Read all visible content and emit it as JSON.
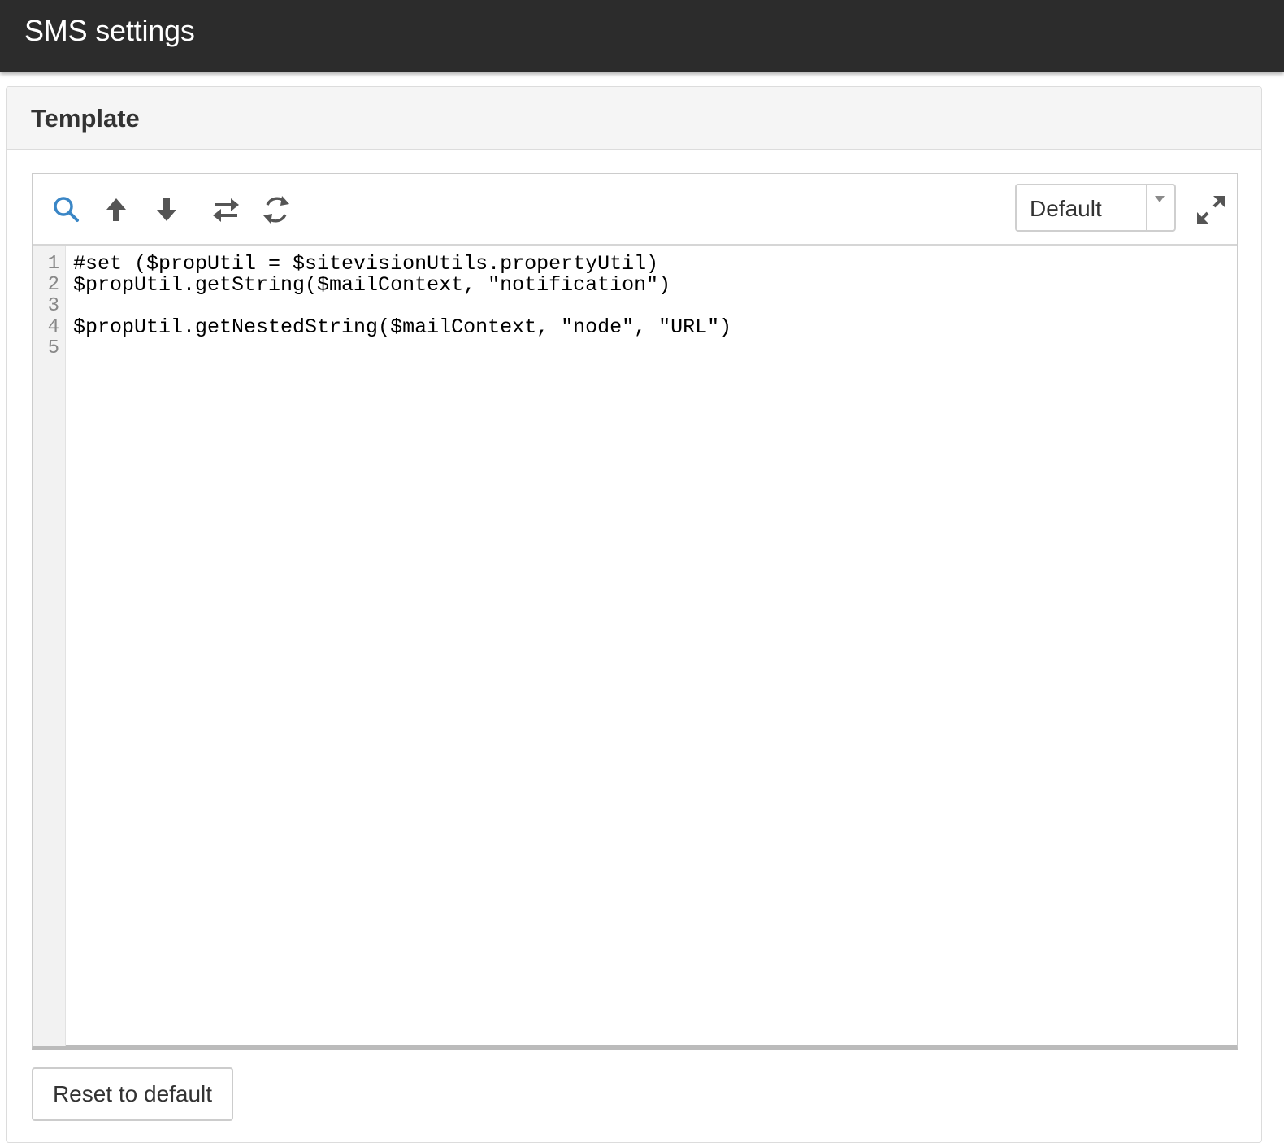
{
  "app": {
    "title": "SMS settings"
  },
  "panel": {
    "heading": "Template"
  },
  "toolbar": {
    "icons": [
      "search-icon",
      "arrow-up-icon",
      "arrow-down-icon",
      "replace-icon",
      "refresh-icon"
    ],
    "theme_select": {
      "selected": "Default"
    },
    "expand_icon": "expand-icon"
  },
  "editor": {
    "lines": [
      {
        "num": "1",
        "text": "#set ($propUtil = $sitevisionUtils.propertyUtil)"
      },
      {
        "num": "2",
        "text": "$propUtil.getString($mailContext, \"notification\")"
      },
      {
        "num": "3",
        "text": ""
      },
      {
        "num": "4",
        "text": "$propUtil.getNestedString($mailContext, \"node\", \"URL\")"
      },
      {
        "num": "5",
        "text": ""
      }
    ]
  },
  "actions": {
    "reset_label": "Reset to default"
  },
  "colors": {
    "titlebar_bg": "#2c2c2c",
    "accent_blue": "#3a86c6",
    "icon_gray": "#555555"
  }
}
